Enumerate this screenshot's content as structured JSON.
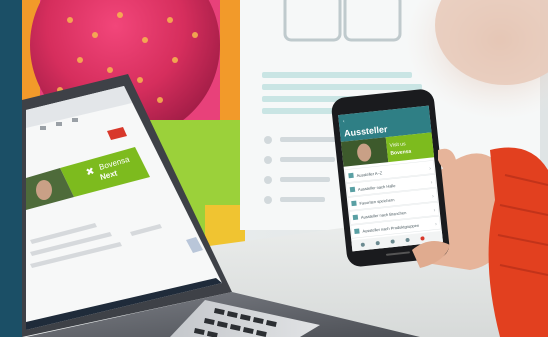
{
  "laptop": {
    "brand_line1": "Bovensa",
    "brand_line2": "Next",
    "accent_green": "#7dbb1e",
    "browser_button_red": "#d8382b"
  },
  "phone": {
    "header_title": "Aussteller",
    "hero_text_line1": "Visit us",
    "hero_text_line2": "Bovensa",
    "menu_items": [
      "Aussteller A–Z",
      "Aussteller nach Halle",
      "Favoriten speichern",
      "Aussteller nach Branchen",
      "Aussteller nach Produktgruppen"
    ],
    "header_color": "#2f7f85",
    "hero_color": "#7dbb1e"
  },
  "colors": {
    "left_bar": "#1b4f66",
    "sweater": "#e2401f",
    "skin": "#e6b49a"
  }
}
